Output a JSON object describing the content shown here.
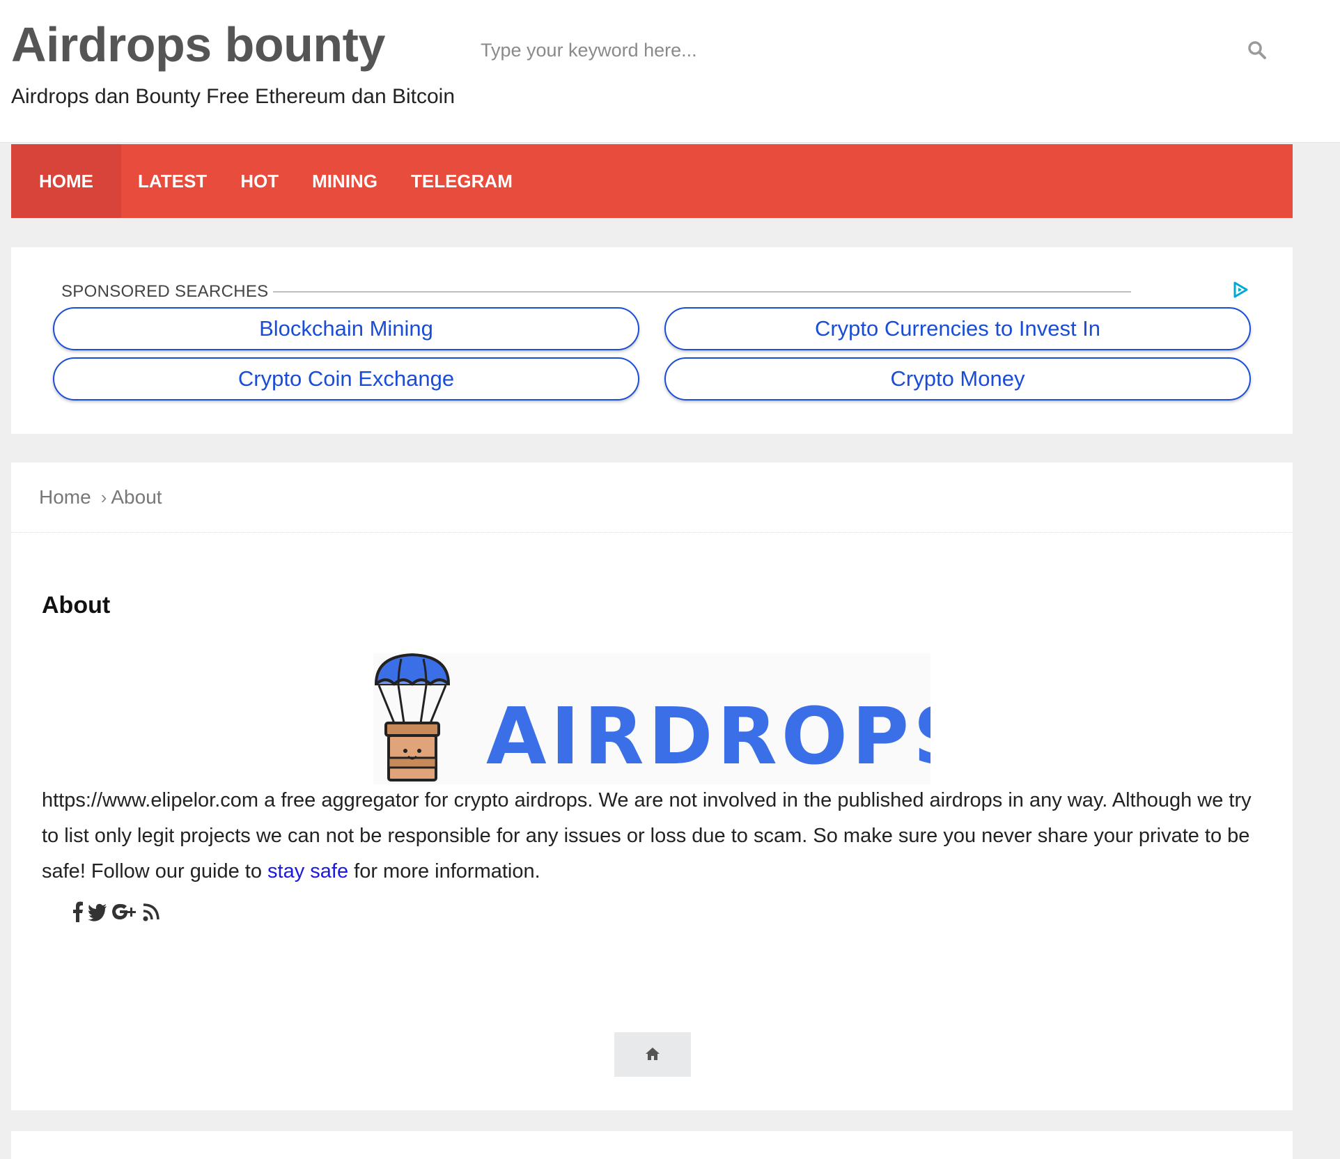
{
  "site": {
    "title": "Airdrops bounty",
    "tagline": "Airdrops dan Bounty Free Ethereum dan Bitcoin"
  },
  "search": {
    "placeholder": "Type your keyword here...",
    "icon": "search-icon"
  },
  "nav": {
    "items": [
      {
        "label": "HOME",
        "active": true
      },
      {
        "label": "LATEST"
      },
      {
        "label": "HOT"
      },
      {
        "label": "MINING"
      },
      {
        "label": "TELEGRAM"
      }
    ],
    "color": "#e74c3c"
  },
  "ads": {
    "heading": "SPONSORED SEARCHES",
    "icon": "adchoices-icon",
    "links": [
      "Blockchain Mining",
      "Crypto Currencies to Invest In",
      "Crypto Coin Exchange",
      "Crypto Money"
    ],
    "link_color": "#1a4dd6"
  },
  "breadcrumb": {
    "items": [
      "Home",
      "About"
    ]
  },
  "page": {
    "heading": "About",
    "logo_text": "AIRDROPS",
    "body_text_before": "https://www.elipelor.com a free aggregator for crypto airdrops. We are not involved in the published airdrops in any way. Although we try to list only legit projects we can not be responsible for any issues or loss due to scam. So make sure you never share your private to be safe! Follow our guide to ",
    "body_link": "stay safe",
    "body_text_after": " for more information.",
    "link_color": "#1a1adf"
  },
  "social_icons": [
    "facebook-icon",
    "twitter-icon",
    "google-plus-icon",
    "rss-icon"
  ],
  "home_button_icon": "home-icon"
}
